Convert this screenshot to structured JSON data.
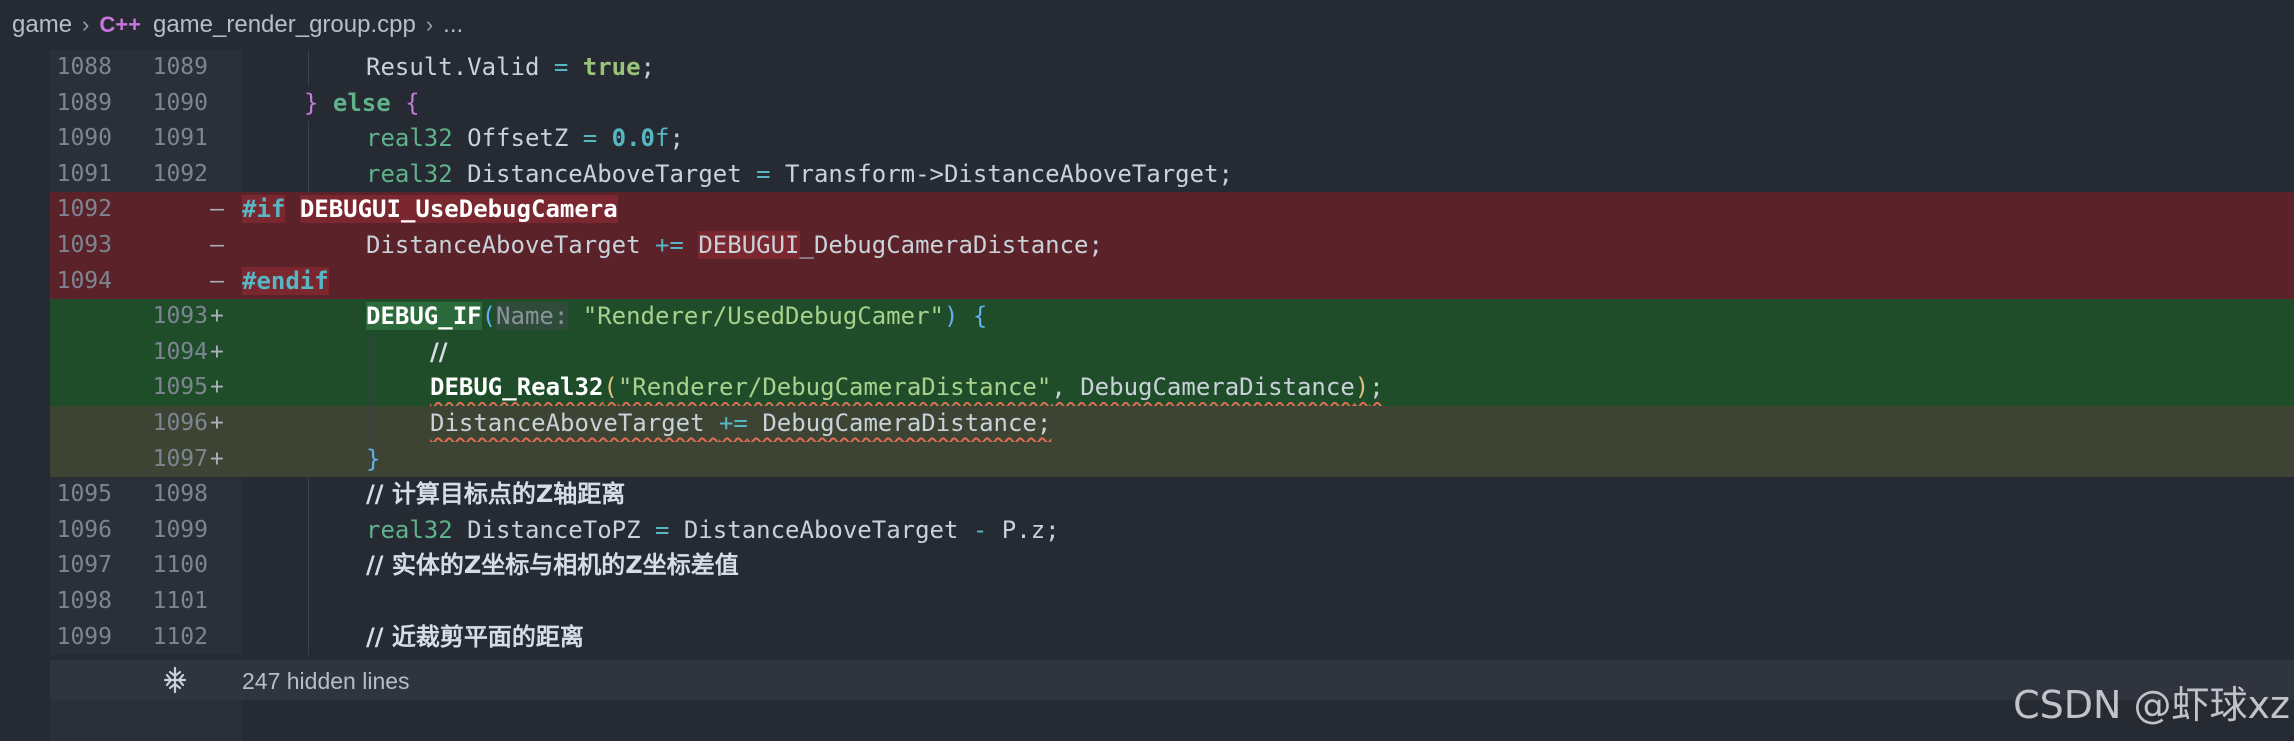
{
  "breadcrumb": {
    "folder": "game",
    "file_icon": "C++",
    "file": "game_render_group.cpp",
    "rest": "..."
  },
  "lines": [
    {
      "old": "1088",
      "new": "1089",
      "mark": "",
      "t1": "Result.Valid ",
      "t2": "=",
      "t3": " ",
      "t4": "true",
      "t5": ";"
    },
    {
      "old": "1089",
      "new": "1090",
      "mark": "",
      "t1": "} ",
      "t2": "else",
      "t3": " {"
    },
    {
      "old": "1090",
      "new": "1091",
      "mark": "",
      "t1": "real32",
      "t2": " OffsetZ ",
      "t3": "=",
      "t4": " ",
      "t5": "0.0",
      "t6": "f",
      "t7": ";"
    },
    {
      "old": "1091",
      "new": "1092",
      "mark": "",
      "t1": "real32",
      "t2": " DistanceAboveTarget ",
      "t3": "=",
      "t4": " Transform->DistanceAboveTarget;"
    },
    {
      "old": "1092",
      "new": "",
      "mark": "—",
      "t1": "#if",
      "t2": " ",
      "t3": "DEBUGUI_UseDebugCamera"
    },
    {
      "old": "1093",
      "new": "",
      "mark": "—",
      "t1": "DistanceAboveTarget ",
      "t2": "+=",
      "t3": " ",
      "t4": "DEBUGUI",
      "t5": "_DebugCameraDistance;"
    },
    {
      "old": "1094",
      "new": "",
      "mark": "—",
      "t1": "#endif"
    },
    {
      "old": "",
      "new": "1093",
      "mark": "+",
      "t1": "DEBUG_IF",
      "t2": "(",
      "t3": "Name:",
      "t4": " ",
      "t5": "\"Renderer/UsedDebugCamer\"",
      "t6": ")",
      "t7": " {"
    },
    {
      "old": "",
      "new": "1094",
      "mark": "+",
      "t1": "//"
    },
    {
      "old": "",
      "new": "1095",
      "mark": "+",
      "t1": "DEBUG_Real32",
      "t2": "(",
      "t3": "\"Renderer/DebugCameraDistance\"",
      "t4": ", DebugCameraDistance",
      "t5": ")",
      "t6": ";"
    },
    {
      "old": "",
      "new": "1096",
      "mark": "+",
      "t1": "DistanceAboveTarget ",
      "t2": "+=",
      "t3": " DebugCameraDistance;"
    },
    {
      "old": "",
      "new": "1097",
      "mark": "+",
      "t1": "}"
    },
    {
      "old": "1095",
      "new": "1098",
      "mark": "",
      "t1": "// 计算目标点的Z轴距离"
    },
    {
      "old": "1096",
      "new": "1099",
      "mark": "",
      "t1": "real32",
      "t2": " DistanceToPZ ",
      "t3": "=",
      "t4": " DistanceAboveTarget ",
      "t5": "-",
      "t6": " P.z;"
    },
    {
      "old": "1097",
      "new": "1100",
      "mark": "",
      "t1": "// 实体的Z坐标与相机的Z坐标差值"
    },
    {
      "old": "1098",
      "new": "1101",
      "mark": "",
      "t1": ""
    },
    {
      "old": "1099",
      "new": "1102",
      "mark": "",
      "t1": "// 近裁剪平面的距离"
    }
  ],
  "fold": {
    "icon": "unfold-icon",
    "text": "247 hidden lines"
  },
  "watermark": "CSDN @虾球xz",
  "colors": {
    "removed_bg": "#5b222a",
    "added_bg": "#1f4d2a",
    "editor_bg": "#262a33"
  }
}
